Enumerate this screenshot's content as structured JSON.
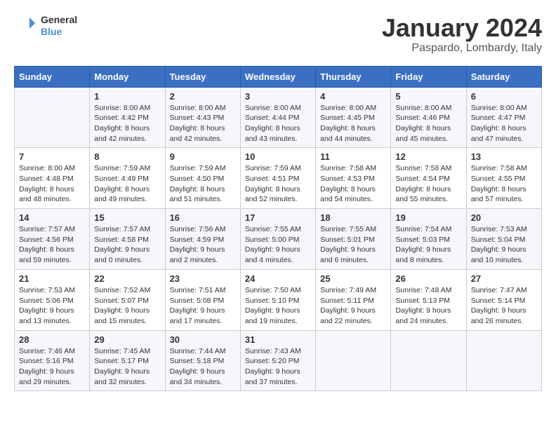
{
  "logo": {
    "text_general": "General",
    "text_blue": "Blue"
  },
  "header": {
    "month_title": "January 2024",
    "subtitle": "Paspardo, Lombardy, Italy"
  },
  "weekdays": [
    "Sunday",
    "Monday",
    "Tuesday",
    "Wednesday",
    "Thursday",
    "Friday",
    "Saturday"
  ],
  "weeks": [
    [
      {
        "day": "",
        "info": ""
      },
      {
        "day": "1",
        "info": "Sunrise: 8:00 AM\nSunset: 4:42 PM\nDaylight: 8 hours\nand 42 minutes."
      },
      {
        "day": "2",
        "info": "Sunrise: 8:00 AM\nSunset: 4:43 PM\nDaylight: 8 hours\nand 42 minutes."
      },
      {
        "day": "3",
        "info": "Sunrise: 8:00 AM\nSunset: 4:44 PM\nDaylight: 8 hours\nand 43 minutes."
      },
      {
        "day": "4",
        "info": "Sunrise: 8:00 AM\nSunset: 4:45 PM\nDaylight: 8 hours\nand 44 minutes."
      },
      {
        "day": "5",
        "info": "Sunrise: 8:00 AM\nSunset: 4:46 PM\nDaylight: 8 hours\nand 45 minutes."
      },
      {
        "day": "6",
        "info": "Sunrise: 8:00 AM\nSunset: 4:47 PM\nDaylight: 8 hours\nand 47 minutes."
      }
    ],
    [
      {
        "day": "7",
        "info": "Sunrise: 8:00 AM\nSunset: 4:48 PM\nDaylight: 8 hours\nand 48 minutes."
      },
      {
        "day": "8",
        "info": "Sunrise: 7:59 AM\nSunset: 4:49 PM\nDaylight: 8 hours\nand 49 minutes."
      },
      {
        "day": "9",
        "info": "Sunrise: 7:59 AM\nSunset: 4:50 PM\nDaylight: 8 hours\nand 51 minutes."
      },
      {
        "day": "10",
        "info": "Sunrise: 7:59 AM\nSunset: 4:51 PM\nDaylight: 8 hours\nand 52 minutes."
      },
      {
        "day": "11",
        "info": "Sunrise: 7:58 AM\nSunset: 4:53 PM\nDaylight: 8 hours\nand 54 minutes."
      },
      {
        "day": "12",
        "info": "Sunrise: 7:58 AM\nSunset: 4:54 PM\nDaylight: 8 hours\nand 55 minutes."
      },
      {
        "day": "13",
        "info": "Sunrise: 7:58 AM\nSunset: 4:55 PM\nDaylight: 8 hours\nand 57 minutes."
      }
    ],
    [
      {
        "day": "14",
        "info": "Sunrise: 7:57 AM\nSunset: 4:56 PM\nDaylight: 8 hours\nand 59 minutes."
      },
      {
        "day": "15",
        "info": "Sunrise: 7:57 AM\nSunset: 4:58 PM\nDaylight: 9 hours\nand 0 minutes."
      },
      {
        "day": "16",
        "info": "Sunrise: 7:56 AM\nSunset: 4:59 PM\nDaylight: 9 hours\nand 2 minutes."
      },
      {
        "day": "17",
        "info": "Sunrise: 7:55 AM\nSunset: 5:00 PM\nDaylight: 9 hours\nand 4 minutes."
      },
      {
        "day": "18",
        "info": "Sunrise: 7:55 AM\nSunset: 5:01 PM\nDaylight: 9 hours\nand 6 minutes."
      },
      {
        "day": "19",
        "info": "Sunrise: 7:54 AM\nSunset: 5:03 PM\nDaylight: 9 hours\nand 8 minutes."
      },
      {
        "day": "20",
        "info": "Sunrise: 7:53 AM\nSunset: 5:04 PM\nDaylight: 9 hours\nand 10 minutes."
      }
    ],
    [
      {
        "day": "21",
        "info": "Sunrise: 7:53 AM\nSunset: 5:06 PM\nDaylight: 9 hours\nand 13 minutes."
      },
      {
        "day": "22",
        "info": "Sunrise: 7:52 AM\nSunset: 5:07 PM\nDaylight: 9 hours\nand 15 minutes."
      },
      {
        "day": "23",
        "info": "Sunrise: 7:51 AM\nSunset: 5:08 PM\nDaylight: 9 hours\nand 17 minutes."
      },
      {
        "day": "24",
        "info": "Sunrise: 7:50 AM\nSunset: 5:10 PM\nDaylight: 9 hours\nand 19 minutes."
      },
      {
        "day": "25",
        "info": "Sunrise: 7:49 AM\nSunset: 5:11 PM\nDaylight: 9 hours\nand 22 minutes."
      },
      {
        "day": "26",
        "info": "Sunrise: 7:48 AM\nSunset: 5:13 PM\nDaylight: 9 hours\nand 24 minutes."
      },
      {
        "day": "27",
        "info": "Sunrise: 7:47 AM\nSunset: 5:14 PM\nDaylight: 9 hours\nand 26 minutes."
      }
    ],
    [
      {
        "day": "28",
        "info": "Sunrise: 7:46 AM\nSunset: 5:16 PM\nDaylight: 9 hours\nand 29 minutes."
      },
      {
        "day": "29",
        "info": "Sunrise: 7:45 AM\nSunset: 5:17 PM\nDaylight: 9 hours\nand 32 minutes."
      },
      {
        "day": "30",
        "info": "Sunrise: 7:44 AM\nSunset: 5:18 PM\nDaylight: 9 hours\nand 34 minutes."
      },
      {
        "day": "31",
        "info": "Sunrise: 7:43 AM\nSunset: 5:20 PM\nDaylight: 9 hours\nand 37 minutes."
      },
      {
        "day": "",
        "info": ""
      },
      {
        "day": "",
        "info": ""
      },
      {
        "day": "",
        "info": ""
      }
    ]
  ]
}
